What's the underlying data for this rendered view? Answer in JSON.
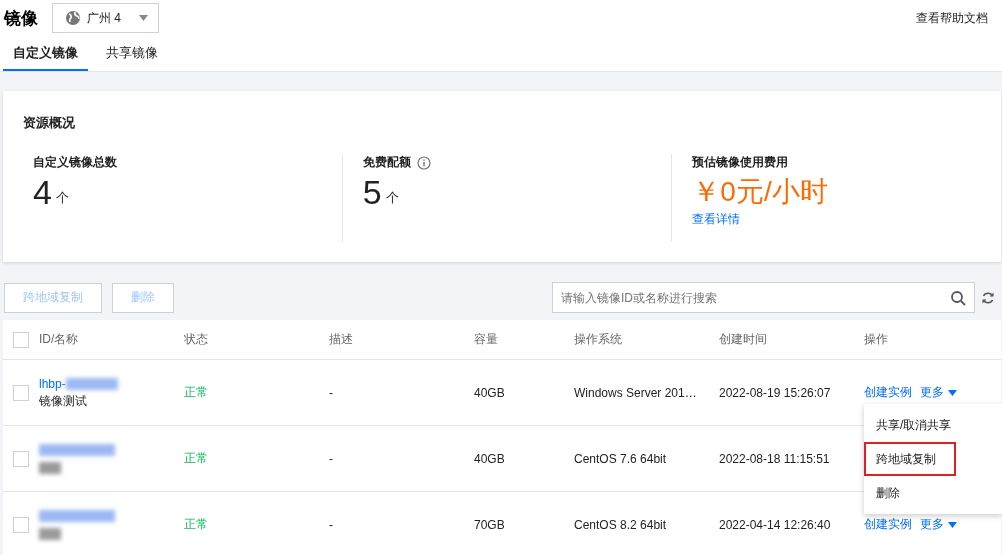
{
  "header": {
    "title": "镜像",
    "region": "广州 4",
    "help_link": "查看帮助文档"
  },
  "tabs": [
    {
      "label": "自定义镜像",
      "selected": true
    },
    {
      "label": "共享镜像",
      "selected": false
    }
  ],
  "overview": {
    "title": "资源概况",
    "stats": [
      {
        "kind": "count",
        "label": "自定义镜像总数",
        "value": "4",
        "unit": "个",
        "info": false
      },
      {
        "kind": "count",
        "label": "免费配额",
        "value": "5",
        "unit": "个",
        "info": true
      },
      {
        "kind": "cost",
        "label": "预估镜像使用费用",
        "value": "￥0元/小时",
        "link": "查看详情",
        "info": false
      }
    ]
  },
  "toolbar": {
    "buttons": [
      {
        "label": "跨地域复制",
        "disabled": true
      },
      {
        "label": "删除",
        "disabled": true
      }
    ],
    "search": {
      "placeholder": "请输入镜像ID或名称进行搜索"
    }
  },
  "table": {
    "all_checked": false,
    "columns": [
      "ID/名称",
      "状态",
      "描述",
      "容量",
      "操作系统",
      "创建时间",
      "操作"
    ],
    "rows": [
      {
        "checked": false,
        "id": "lhbp-",
        "id_redacted": true,
        "name": "镜像测试",
        "name_redacted": false,
        "status": "正常",
        "description": "-",
        "size": "40GB",
        "os": "Windows Server 201…",
        "created": "2022-08-19 15:26:07",
        "actions": [
          "创建实例",
          "更多"
        ]
      },
      {
        "checked": false,
        "id_redacted": true,
        "name_redacted": true,
        "status": "正常",
        "description": "-",
        "size": "40GB",
        "os": "CentOS 7.6 64bit",
        "created": "2022-08-18 11:15:51",
        "actions": []
      },
      {
        "checked": false,
        "id_redacted": true,
        "name_redacted": true,
        "status": "正常",
        "description": "-",
        "size": "70GB",
        "os": "CentOS 8.2 64bit",
        "created": "2022-04-14 12:26:40",
        "actions": [
          "创建实例",
          "更多"
        ]
      }
    ]
  },
  "menu": {
    "items": [
      {
        "label": "共享/取消共享",
        "highlighted": false
      },
      {
        "label": "跨地域复制",
        "highlighted": true
      },
      {
        "label": "删除",
        "highlighted": false
      }
    ]
  }
}
